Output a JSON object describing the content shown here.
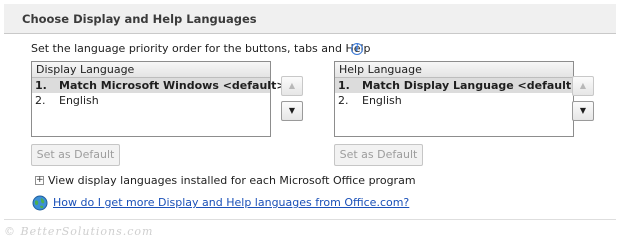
{
  "section": {
    "title": "Choose Display and Help Languages"
  },
  "instruction": {
    "text": "Set the language priority order for the buttons, tabs and Help",
    "info_icon": "i"
  },
  "display_list": {
    "header": "Display Language",
    "items": [
      {
        "num": "1.",
        "label": "Match Microsoft Windows <default>",
        "selected": true
      },
      {
        "num": "2.",
        "label": "English",
        "selected": false
      }
    ],
    "set_default_label": "Set as Default"
  },
  "help_list": {
    "header": "Help Language",
    "items": [
      {
        "num": "1.",
        "label": "Match Display Language <default>",
        "selected": true
      },
      {
        "num": "2.",
        "label": "English",
        "selected": false
      }
    ],
    "set_default_label": "Set as Default"
  },
  "arrows": {
    "up": "▲",
    "down": "▼"
  },
  "expand": {
    "symbol": "+",
    "text": "View display languages installed for each Microsoft Office program"
  },
  "link": {
    "text": "How do I get more Display and Help languages from Office.com?",
    "icon": "globe-icon"
  },
  "watermark": {
    "text": "© BetterSolutions.com"
  },
  "colors": {
    "link": "#1a50b8",
    "selected_row": "#dcdcdc",
    "header_bg": "#f0f0f0"
  }
}
